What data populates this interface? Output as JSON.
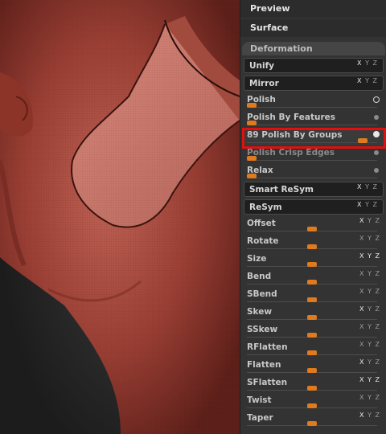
{
  "menu": {
    "preview_label": "Preview",
    "surface_label": "Surface",
    "deformation_label": "Deformation"
  },
  "deformation": {
    "unify": {
      "label": "Unify",
      "axes": "X Y Z",
      "active_axes": [
        true,
        false,
        false
      ]
    },
    "mirror": {
      "label": "Mirror",
      "axes": "X Y Z",
      "active_axes": [
        true,
        false,
        false
      ]
    },
    "polish": {
      "label": "Polish",
      "value_fraction": 0.04,
      "indicator": "ring"
    },
    "polish_by_features": {
      "label": "Polish By Features",
      "value_fraction": 0.04
    },
    "polish_by_groups": {
      "label": "89 Polish By Groups",
      "value_fraction": 0.89,
      "indicator": "on"
    },
    "polish_crisp_edges": {
      "label": "Polish Crisp Edges",
      "value_fraction": 0.04
    },
    "relax": {
      "label": "Relax",
      "value_fraction": 0.04
    },
    "smart_resym": {
      "label": "Smart ReSym",
      "axes": "X Y Z",
      "active_axes": [
        true,
        false,
        false
      ]
    },
    "resym": {
      "label": "ReSym",
      "axes": "X Y Z",
      "active_axes": [
        true,
        false,
        false
      ]
    },
    "sliders": [
      {
        "label": "Offset",
        "axes": "X Y Z",
        "active_axes": [
          true,
          false,
          false
        ],
        "value_fraction": 0.5
      },
      {
        "label": "Rotate",
        "axes": "X Y Z",
        "active_axes": [
          false,
          false,
          false
        ],
        "value_fraction": 0.5
      },
      {
        "label": "Size",
        "axes": "X Y Z",
        "active_axes": [
          true,
          true,
          true
        ],
        "value_fraction": 0.5
      },
      {
        "label": "Bend",
        "axes": "X Y Z",
        "active_axes": [
          false,
          false,
          false
        ],
        "value_fraction": 0.5
      },
      {
        "label": "SBend",
        "axes": "X Y Z",
        "active_axes": [
          false,
          false,
          false
        ],
        "value_fraction": 0.5
      },
      {
        "label": "Skew",
        "axes": "X Y Z",
        "active_axes": [
          true,
          false,
          false
        ],
        "value_fraction": 0.5
      },
      {
        "label": "SSkew",
        "axes": "X Y Z",
        "active_axes": [
          false,
          false,
          false
        ],
        "value_fraction": 0.5
      },
      {
        "label": "RFlatten",
        "axes": "X Y Z",
        "active_axes": [
          false,
          false,
          false
        ],
        "value_fraction": 0.5
      },
      {
        "label": "Flatten",
        "axes": "X Y Z",
        "active_axes": [
          true,
          false,
          false
        ],
        "value_fraction": 0.5
      },
      {
        "label": "SFlatten",
        "axes": "X Y Z",
        "active_axes": [
          true,
          true,
          true
        ],
        "value_fraction": 0.5
      },
      {
        "label": "Twist",
        "axes": "X Y Z",
        "active_axes": [
          false,
          false,
          false
        ],
        "value_fraction": 0.5
      },
      {
        "label": "Taper",
        "axes": "X Y Z",
        "active_axes": [
          true,
          false,
          false
        ],
        "value_fraction": 0.5
      }
    ]
  },
  "colors": {
    "accent": "#e07a1f",
    "highlight": "#e01010",
    "mesh": "#b5574a"
  }
}
